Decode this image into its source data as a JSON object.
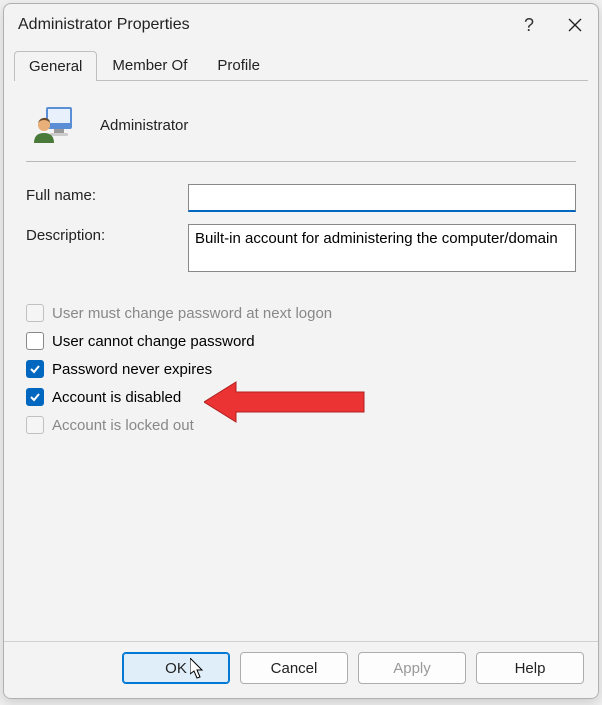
{
  "title": "Administrator Properties",
  "tabs": [
    {
      "label": "General",
      "active": true
    },
    {
      "label": "Member Of",
      "active": false
    },
    {
      "label": "Profile",
      "active": false
    }
  ],
  "user": {
    "name": "Administrator"
  },
  "fields": {
    "full_name_label": "Full name:",
    "full_name_value": "",
    "description_label": "Description:",
    "description_value": "Built-in account for administering the computer/domain"
  },
  "checkboxes": [
    {
      "label": "User must change password at next logon",
      "checked": false,
      "enabled": false
    },
    {
      "label": "User cannot change password",
      "checked": false,
      "enabled": true
    },
    {
      "label": "Password never expires",
      "checked": true,
      "enabled": true
    },
    {
      "label": "Account is disabled",
      "checked": true,
      "enabled": true
    },
    {
      "label": "Account is locked out",
      "checked": false,
      "enabled": false
    }
  ],
  "buttons": {
    "ok": "OK",
    "cancel": "Cancel",
    "apply": "Apply",
    "help": "Help"
  },
  "colors": {
    "accent": "#0067c0",
    "annotation": "#eb3333"
  }
}
